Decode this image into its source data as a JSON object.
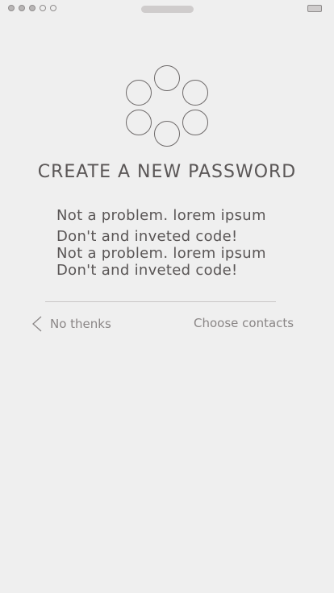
{
  "status_bar": {
    "signal_dots": [
      "filled",
      "filled",
      "filled",
      "empty",
      "empty"
    ]
  },
  "title": "CREATE A NEW PASSWORD",
  "message": [
    "Not a problem. lorem ipsum",
    "Don't and inveted code!",
    "Not a problem. lorem ipsum",
    "Don't and inveted code!"
  ],
  "actions": {
    "back_label": "No thenks",
    "choose_label": "Choose contacts"
  },
  "colors": {
    "background": "#efefef",
    "text": "#5a5656",
    "muted_text": "#8a8686"
  }
}
